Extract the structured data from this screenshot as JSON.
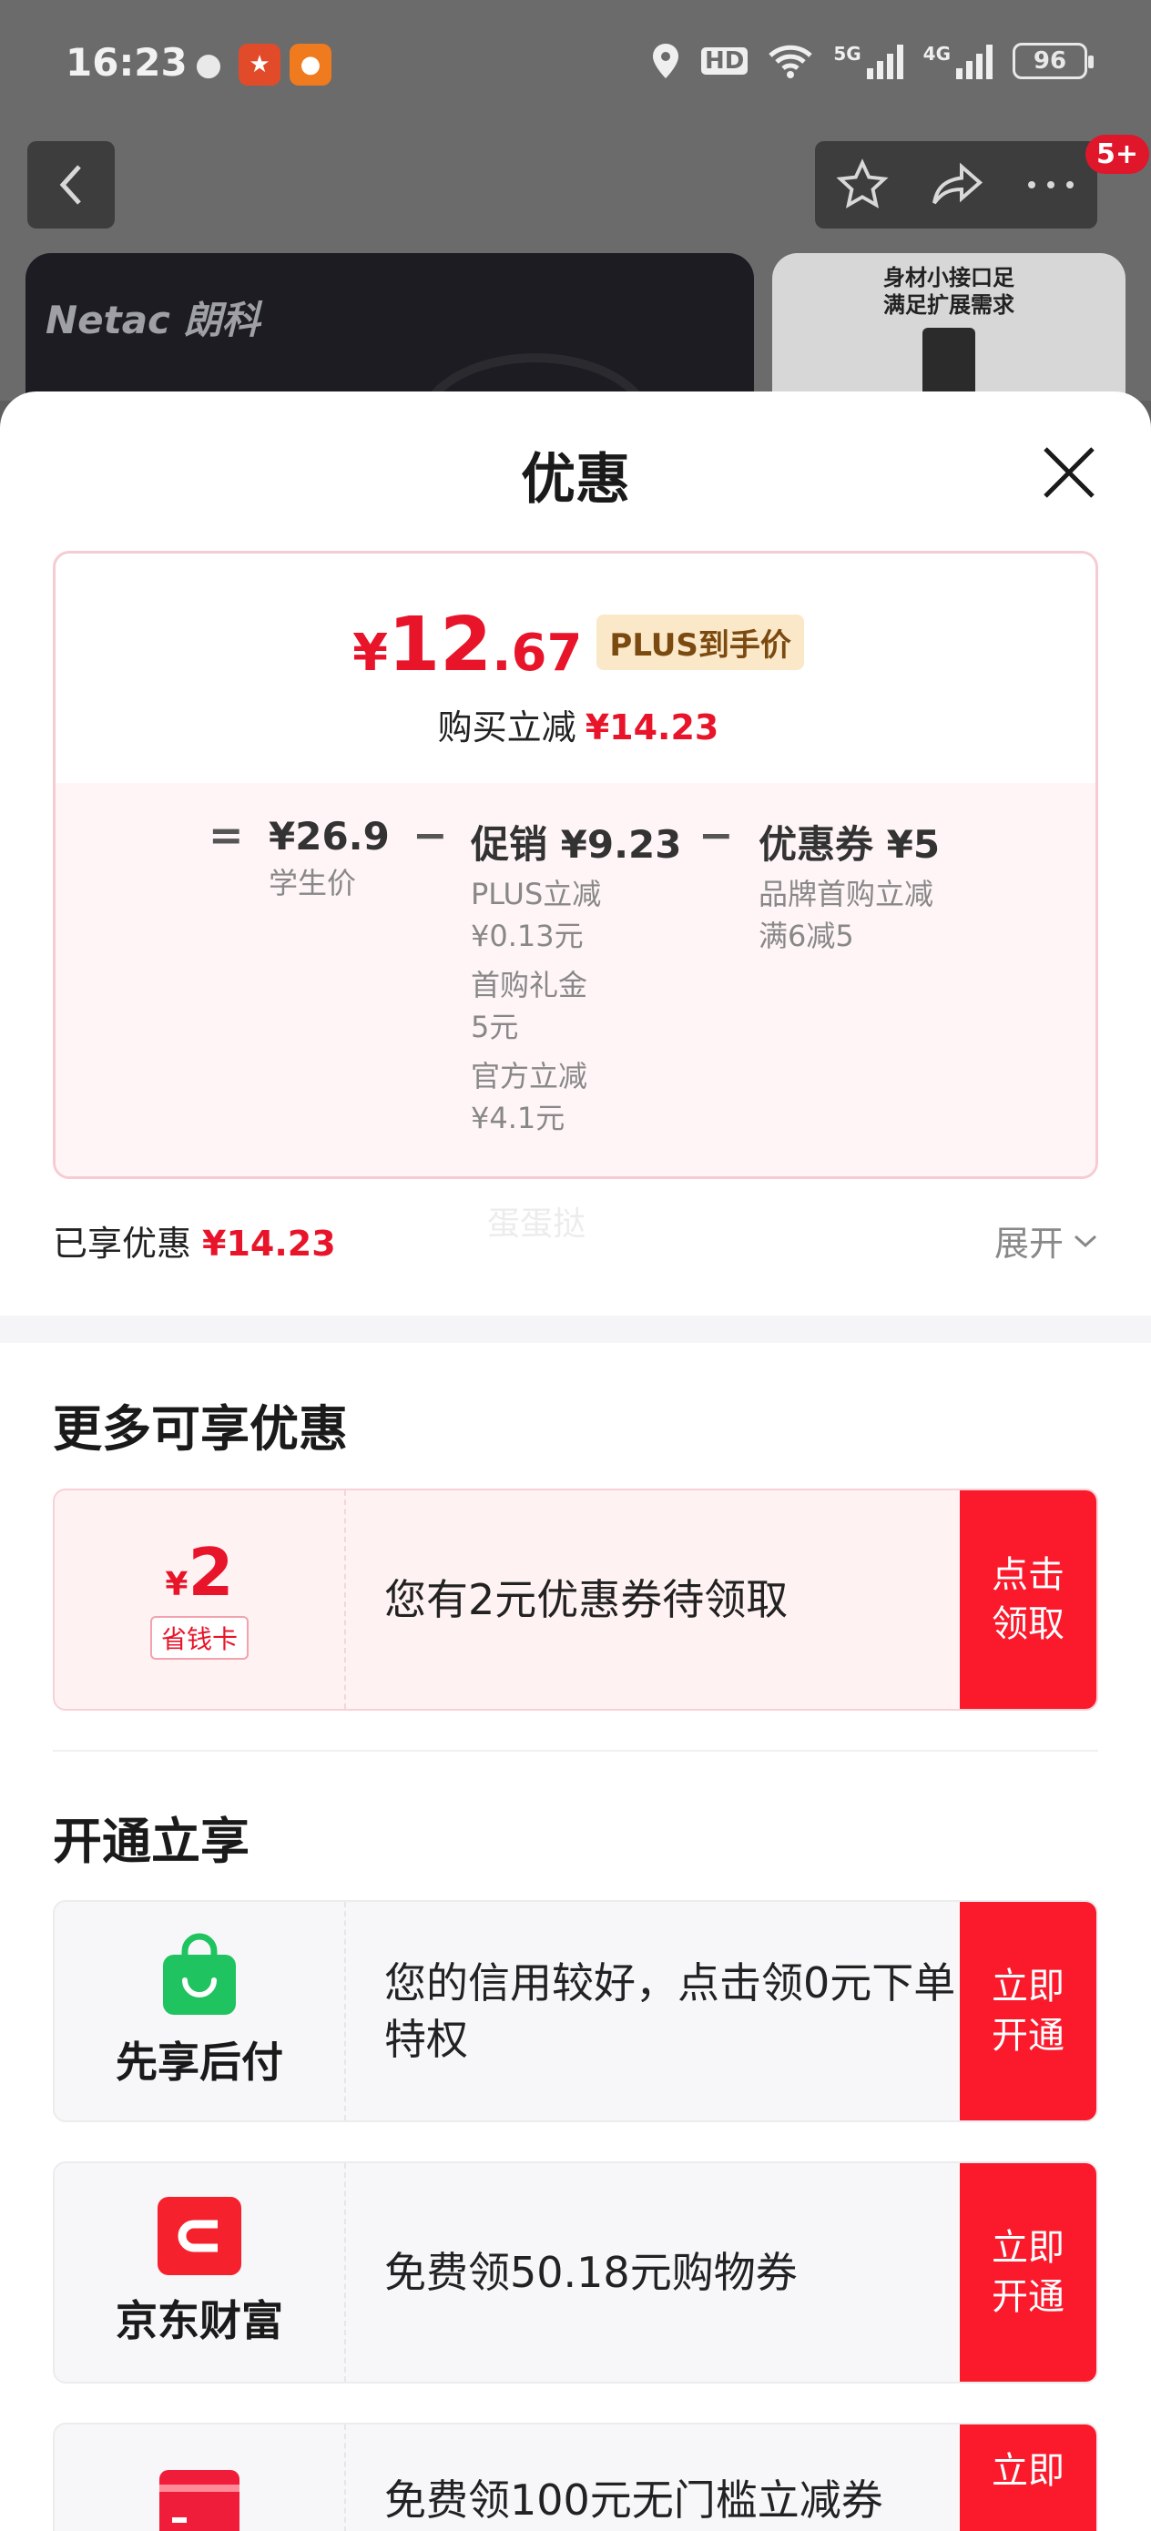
{
  "status_bar": {
    "time": "16:23",
    "hd": "HD",
    "net5g": "5G",
    "net4g": "4G",
    "battery": "96"
  },
  "nav": {
    "badge": "5+"
  },
  "product": {
    "brand": "Netac 朗科",
    "side_caption_1": "身材小接口足",
    "side_caption_2": "满足扩展需求"
  },
  "sheet": {
    "title": "优惠"
  },
  "price": {
    "final_yen": "¥",
    "final_int": "12",
    "final_dec": ".67",
    "plus_tag": "PLUS到手价",
    "buy_reduce_label": "购买立减",
    "buy_reduce_value": "¥14.23"
  },
  "breakdown": {
    "eq": "=",
    "minus": "−",
    "student_price": "¥26.9",
    "student_label": "学生价",
    "promo_main": "促销 ¥9.23",
    "promo_items": [
      {
        "l1": "PLUS立减",
        "l2": "¥0.13元"
      },
      {
        "l1": "首购礼金",
        "l2": "5元"
      },
      {
        "l1": "官方立减",
        "l2": "¥4.1元"
      }
    ],
    "coupon_main": "优惠券 ¥5",
    "coupon_l1": "品牌首购立减",
    "coupon_l2": "满6减5"
  },
  "summary": {
    "enjoyed_label": "已享优惠",
    "enjoyed_value": "¥14.23",
    "watermark": "蛋蛋挞",
    "expand_label": "展开"
  },
  "more_offers": {
    "title": "更多可享优惠",
    "card": {
      "yen": "¥",
      "amount": "2",
      "tag": "省钱卡",
      "text": "您有2元优惠券待领取",
      "button": "点击\n领取"
    }
  },
  "open_enjoy": {
    "title": "开通立享",
    "items": [
      {
        "name": "先享后付",
        "text": "您的信用较好，点击领0元下单特权",
        "button": "立即开通",
        "icon": "shopping-bag-icon",
        "color": "#1fc35f"
      },
      {
        "name": "京东财富",
        "text": "免费领50.18元购物券",
        "button": "立即开通",
        "icon": "jd-wealth-icon",
        "color": "#f5222d"
      },
      {
        "name": "",
        "text": "免费领100元无门槛立减券",
        "button": "立即",
        "icon": "card-icon",
        "color": "#f01d3a"
      }
    ]
  },
  "colors": {
    "accent_red": "#e8142a",
    "button_red": "#fa1a2c",
    "plus_gold_bg": "#fbe8c8"
  }
}
